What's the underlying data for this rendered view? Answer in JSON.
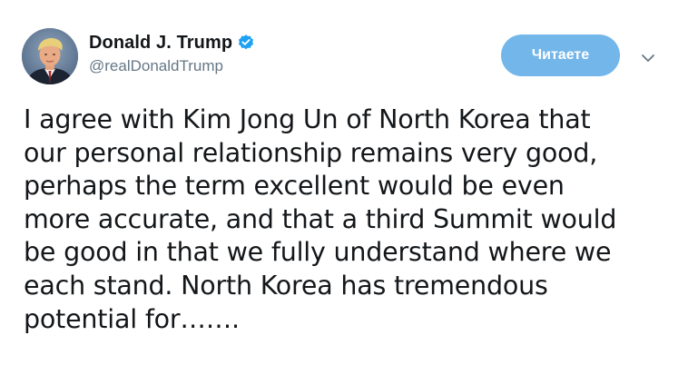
{
  "author": {
    "display_name": "Donald J. Trump",
    "handle": "@realDonaldTrump",
    "verified": true,
    "avatar_icon": "profile-photo"
  },
  "actions": {
    "follow_label": "Читаете",
    "follow_color": "#73b6ea",
    "menu_icon": "chevron-down-icon"
  },
  "tweet": {
    "text": "I agree with Kim Jong Un of North Korea that\nour personal relationship remains very good,\nperhaps the term excellent would be even\nmore accurate, and that a third Summit would\nbe good in that we fully understand where we\neach stand. North Korea has tremendous\npotential for……."
  },
  "colors": {
    "text": "#14171a",
    "secondary_text": "#657786",
    "verified_badge": "#1da1f2"
  }
}
